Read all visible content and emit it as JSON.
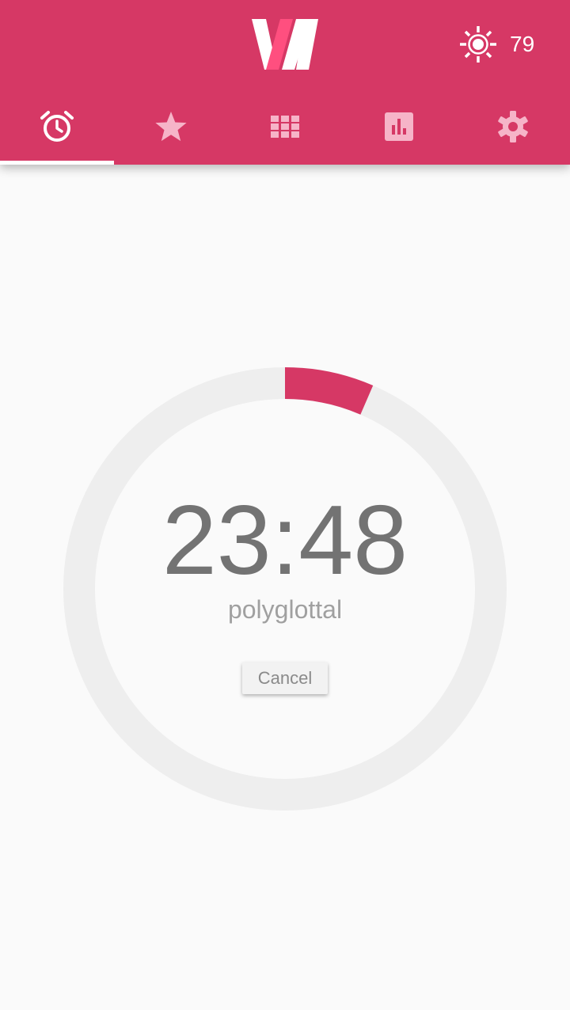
{
  "colors": {
    "brand": "#d63865",
    "logo_accent": "#ff4f7f",
    "tab_active": "#ffffff",
    "tab_inactive": "#f6b4c8",
    "ring_track": "#eeeeee",
    "ring_progress": "#d63865"
  },
  "header": {
    "logo_icon": "logo-w-icon",
    "score": {
      "icon": "sun-icon",
      "value": "79"
    }
  },
  "tabs": [
    {
      "icon": "alarm-clock-icon",
      "active": true
    },
    {
      "icon": "star-icon",
      "active": false
    },
    {
      "icon": "grid-icon",
      "active": false
    },
    {
      "icon": "bar-chart-icon",
      "active": false
    },
    {
      "icon": "gear-icon",
      "active": false
    }
  ],
  "timer": {
    "time": "23:48",
    "word": "polyglottal",
    "progress": 0.065,
    "cancel_label": "Cancel"
  }
}
